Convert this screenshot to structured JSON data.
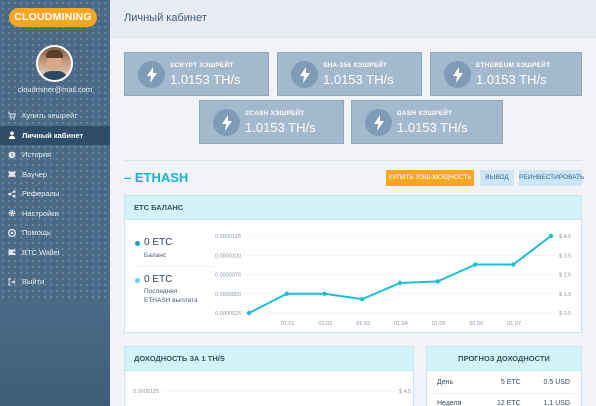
{
  "app": {
    "logo": "CLOUDMINING",
    "page_title": "Личный кабинет"
  },
  "user": {
    "email": "cloudminer@mail.com"
  },
  "sidebar": {
    "items": [
      {
        "label": "Купить хешрейт",
        "icon": "cart-icon",
        "active": false
      },
      {
        "label": "Личный кабинет",
        "icon": "user-icon",
        "active": true
      },
      {
        "label": "История",
        "icon": "clock-icon",
        "active": false
      },
      {
        "label": "Ваучер",
        "icon": "voucher-icon",
        "active": false
      },
      {
        "label": "Рефералы",
        "icon": "share-icon",
        "active": false
      },
      {
        "label": "Настройки",
        "icon": "gear-icon",
        "active": false
      },
      {
        "label": "Помощь",
        "icon": "help-icon",
        "active": false
      },
      {
        "label": "BTC Wallet",
        "icon": "wallet-icon",
        "active": false
      }
    ],
    "logout": {
      "label": "Выйти",
      "icon": "logout-icon"
    }
  },
  "hashrates": [
    {
      "algo": "SCRYPT ХЭШРЕЙТ",
      "value": "1.0153 TH/s"
    },
    {
      "algo": "SHA-256 ХЭШРЕЙТ",
      "value": "1.0153 TH/s"
    },
    {
      "algo": "ETHEREUM ХЭШРЕЙТ",
      "value": "1.0153 TH/s"
    },
    {
      "algo": "ZCASH ХЭШРЕЙТ",
      "value": "1.0153 TH/s"
    },
    {
      "algo": "DASH ХЭШРЕЙТ",
      "value": "1.0153 TH/s"
    }
  ],
  "ethash": {
    "title": "ETHASH",
    "buttons": {
      "buy": "КУПИТЬ ХЭШ-МОЩНОСТЬ",
      "withdraw": "ВЫВОД",
      "reinvest": "РЕИНВЕСТИРОВАТЬ"
    },
    "balance_panel": {
      "title": "ETC БАЛАНС",
      "balance_value": "0 ETC",
      "balance_label": "Баланс",
      "last_value": "0 ETC",
      "last_label_1": "Последняя",
      "last_label_2": "ETHASH выплата"
    },
    "yield_panel": {
      "title": "ДОХОДНОСТЬ ЗА 1 TH/S",
      "left_tick": "0.0000125",
      "right_tick": "$ 4.5"
    },
    "forecast_panel": {
      "title": "ПРОГНОЗ ДОХОДНОСТИ",
      "rows": [
        {
          "period": "День",
          "etc": "5 ETC",
          "usd": "0.5 USD"
        },
        {
          "period": "Неделя",
          "etc": "12 ETC",
          "usd": "1.1 USD"
        }
      ]
    }
  },
  "colors": {
    "accent": "#17b6cc",
    "brand": "#f5a623",
    "sidebar": "#4b6a87",
    "card": "#a3b9cd",
    "line": "#1dbfd6"
  },
  "chart_data": {
    "type": "line",
    "categories": [
      "",
      "01.01",
      "01.02",
      "01.03",
      "01.04",
      "01.05",
      "01.06",
      "01.07",
      ""
    ],
    "series": [
      {
        "values": [
          2.5e-06,
          5e-06,
          5e-06,
          4.3e-06,
          6.4e-06,
          6.6e-06,
          8.8e-06,
          8.8e-06,
          1.25e-05
        ]
      }
    ],
    "y_left_ticks": [
      "0.0000025",
      "0.0000050",
      "0.0000075",
      "0.0000100",
      "0.0000125"
    ],
    "y_right_ticks": [
      "$ 0.5",
      "$ 1.5",
      "$ 2.5",
      "$ 3.5",
      "$ 4.5"
    ],
    "ylim": [
      2.5e-06,
      1.25e-05
    ],
    "grid": true
  }
}
